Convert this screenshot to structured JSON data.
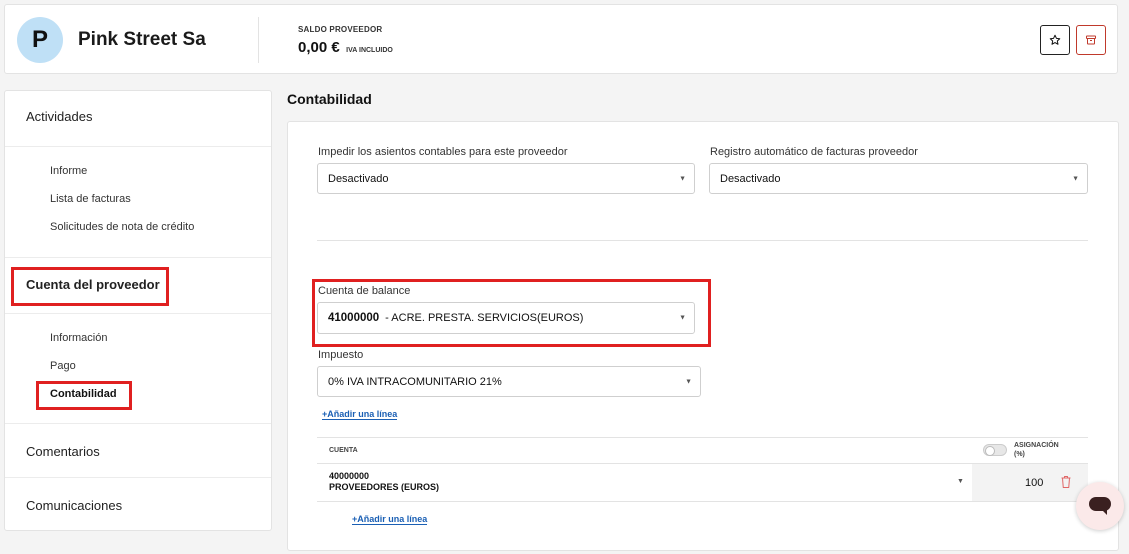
{
  "header": {
    "avatar_letter": "P",
    "vendor_name": "Pink Street Sa",
    "balance_label": "SALDO PROVEEDOR",
    "balance_value": "0,00 €",
    "balance_note": "IVA INCLUIDO",
    "star_icon": "star-icon",
    "archive_icon": "archive-icon",
    "accent_color": "#c0392b"
  },
  "sidebar": {
    "actividades": "Actividades",
    "actividades_items": [
      "Informe",
      "Lista de facturas",
      "Solicitudes de nota de crédito"
    ],
    "cuenta": "Cuenta del proveedor",
    "cuenta_items": [
      "Información",
      "Pago",
      "Contabilidad"
    ],
    "comentarios": "Comentarios",
    "comunicaciones": "Comunicaciones",
    "highlight_color": "#e02020"
  },
  "main": {
    "title": "Contabilidad",
    "prevent_label": "Impedir los asientos contables para este proveedor",
    "prevent_value": "Desactivado",
    "auto_label": "Registro automático de facturas proveedor",
    "auto_value": "Desactivado",
    "balance_account_label": "Cuenta de balance",
    "balance_account_code": "41000000",
    "balance_account_name": "- ACRE. PRESTA. SERVICIOS(EUROS)",
    "tax_label": "Impuesto",
    "tax_value": "0% IVA INTRACOMUNITARIO 21%",
    "add_line": "+Añadir una línea",
    "table": {
      "col_account": "CUENTA",
      "col_alloc_1": "ASIGNACIÓN",
      "col_alloc_2": "(%)",
      "rows": [
        {
          "code": "40000000",
          "name": "PROVEEDORES (EUROS)",
          "allocation": "100"
        }
      ],
      "add_line": "+Añadir una línea"
    }
  },
  "chat_icon": "chat-bubble-icon",
  "link_color": "#1a5fb4"
}
